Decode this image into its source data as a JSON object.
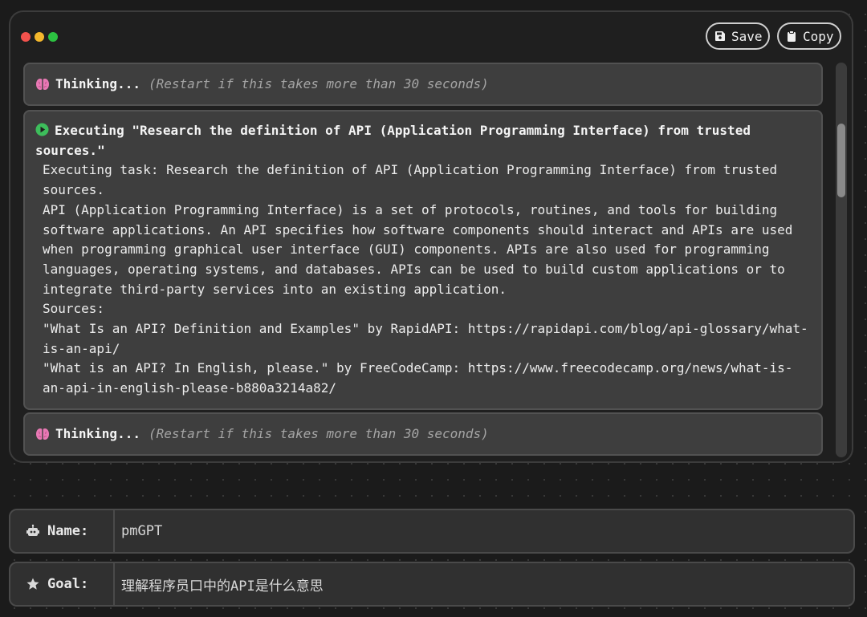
{
  "window": {
    "controls": [
      "close",
      "minimize",
      "maximize"
    ],
    "save_label": "Save",
    "copy_label": "Copy"
  },
  "log": {
    "thinking_label": "Thinking...",
    "thinking_hint": "(Restart if this takes more than 30 seconds)",
    "exec_title": "Executing \"Research the definition of API (Application Programming Interface) from trusted sources.\"",
    "exec_lines": [
      "Executing task: Research the definition of API (Application Programming Interface) from trusted sources.",
      "API (Application Programming Interface) is a set of protocols, routines, and tools for building software applications. An API specifies how software components should interact and APIs are used when programming graphical user interface (GUI) components. APIs are also used for programming languages, operating systems, and databases. APIs can be used to build custom applications or to integrate third-party services into an existing application.",
      "Sources:",
      "\"What Is an API? Definition and Examples\" by RapidAPI: https://rapidapi.com/blog/api-glossary/what-is-an-api/",
      "\"What is an API? In English, please.\" by FreeCodeCamp: https://www.freecodecamp.org/news/what-is-an-api-in-english-please-b880a3214a82/"
    ]
  },
  "form": {
    "name_label": "Name:",
    "name_value": "pmGPT",
    "goal_label": "Goal:",
    "goal_value": "理解程序员口中的API是什么意思"
  },
  "icons": {
    "save": "floppy-disk-icon",
    "copy": "clipboard-icon",
    "thinking": "brain-icon",
    "executing": "play-circle-icon",
    "name": "robot-icon",
    "goal": "star-icon"
  },
  "colors": {
    "brain": "#e879b4",
    "play": "#3dbd5b",
    "close": "#f2524d",
    "minimize": "#f4b72c",
    "maximize": "#2cc241"
  }
}
